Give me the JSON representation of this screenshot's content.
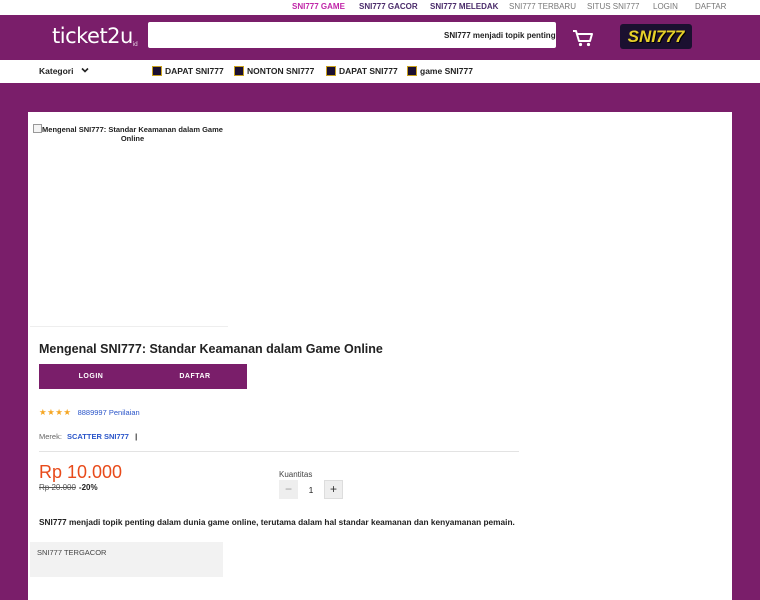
{
  "topbar": {
    "links": [
      "SNI777 GAME",
      "SNI777 GACOR",
      "SNI777 MELEDAK",
      "SNI777 TERBARU",
      "SITUS SNI777",
      "LOGIN",
      "DAFTAR"
    ]
  },
  "header": {
    "logo_text": "ticket2u",
    "logo_suffix": "id",
    "search_value": "SNI777 menjadi topik penting dalam dunia game online",
    "brand_logo": "SNI777"
  },
  "nav": {
    "kategori_label": "Kategori",
    "links": [
      "DAPAT SNI777",
      "NONTON SNI777",
      "DAPAT SNI777",
      "game SNI777"
    ]
  },
  "product": {
    "image_alt": "Mengenal SNI777: Standar Keamanan dalam Game Online",
    "title": "Mengenal SNI777: Standar Keamanan dalam Game Online",
    "login_label": "LOGIN",
    "daftar_label": "DAFTAR",
    "stars": "★★★★",
    "rating_count": "8889997 Penilaian",
    "brand_label": "Merek:",
    "brand_value": "SCATTER SNI777",
    "brand_sep": "|",
    "price": "Rp 10.000",
    "old_price": "Rp 20.000",
    "discount": "-20%",
    "qty_label": "Kuantitas",
    "qty_minus": "−",
    "qty_value": "1",
    "qty_plus": "+",
    "description": "SNI777 menjadi topik penting dalam dunia game online, terutama dalam hal standar keamanan dan kenyamanan pemain.",
    "side_box_label": "SNI777 TERGACOR"
  },
  "colors": {
    "brand_purple": "#7a1e6a",
    "price_orange": "#e84a1a",
    "link_blue": "#2a55c9",
    "star_gold": "#f5a623"
  }
}
